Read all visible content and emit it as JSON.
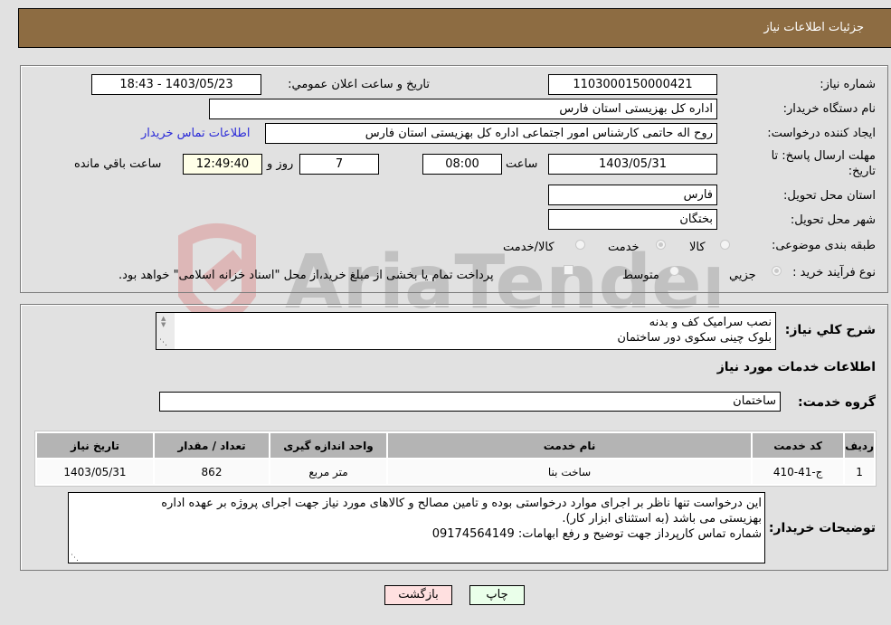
{
  "header": {
    "title": "جزئیات اطلاعات نیاز"
  },
  "fields": {
    "need_number": {
      "label": "شماره نیاز:",
      "value": "1103000150000421"
    },
    "announce_datetime": {
      "label": "تاریخ و ساعت اعلان عمومي:",
      "value": "1403/05/23 - 18:43"
    },
    "buyer_org": {
      "label": "نام دستگاه خریدار:",
      "value": "اداره کل بهزیستی استان فارس"
    },
    "requester": {
      "label": "ایجاد کننده درخواست:",
      "value": "روح اله حاتمی کارشناس امور اجتماعی اداره کل بهزیستی استان فارس"
    },
    "buyer_contact_link": "اطلاعات تماس خریدار",
    "deadline": {
      "label_line1": "مهلت ارسال پاسخ: تا",
      "label_line2": "تاریخ:",
      "date": "1403/05/31",
      "time_label": "ساعت",
      "time": "08:00",
      "days": "7",
      "days_label": "روز و",
      "remaining": "12:49:40",
      "remaining_label": "ساعت باقي مانده"
    },
    "delivery_province": {
      "label": "استان محل تحویل:",
      "value": "فارس"
    },
    "delivery_city": {
      "label": "شهر محل تحویل:",
      "value": "بختگان"
    },
    "category": {
      "label": "طبقه بندی موضوعی:",
      "options": [
        "کالا",
        "خدمت",
        "کالا/خدمت"
      ],
      "selected": "خدمت"
    },
    "purchase_type": {
      "label": "نوع فرآیند خرید :",
      "options": [
        "جزیي",
        "متوسط"
      ],
      "selected": "جزیي",
      "treasury_note": "پرداخت تمام یا بخشی از مبلغ خرید،از محل \"اسناد خزانه اسلامی\" خواهد بود."
    }
  },
  "description": {
    "label": "شرح کلي نیاز:",
    "lines": [
      "نصب سرامیک کف و بدنه",
      "بلوک چینی سکوی دور ساختمان"
    ]
  },
  "services_section": {
    "title": "اطلاعات خدمات مورد نیاز",
    "group_label": "گروه خدمت:",
    "group_value": "ساختمان"
  },
  "table": {
    "headers": [
      "ردیف",
      "کد خدمت",
      "نام خدمت",
      "واحد اندازه گیری",
      "تعداد / مقدار",
      "تاریخ نیاز"
    ],
    "rows": [
      [
        "1",
        "ج-41-410",
        "ساخت بنا",
        "متر مربع",
        "862",
        "1403/05/31"
      ]
    ]
  },
  "buyer_notes": {
    "label": "توضیحات خریدار:",
    "lines": [
      "این درخواست تنها ناظر بر اجرای موارد درخواستی بوده و تامین مصالح و کالاهای مورد نیاز جهت اجرای پروژه بر عهده اداره",
      "بهزیستی می باشد (به استثنای ابزار کار).",
      "شماره تماس کارپرداز جهت توضیح و رفع ابهامات: 09174564149"
    ]
  },
  "buttons": {
    "print": "چاپ",
    "back": "بازگشت"
  },
  "colors": {
    "header_bg": "#8d6c42",
    "print_bg": "#eaffea",
    "back_bg": "#ffe0e0",
    "link": "#2a2ad8"
  }
}
